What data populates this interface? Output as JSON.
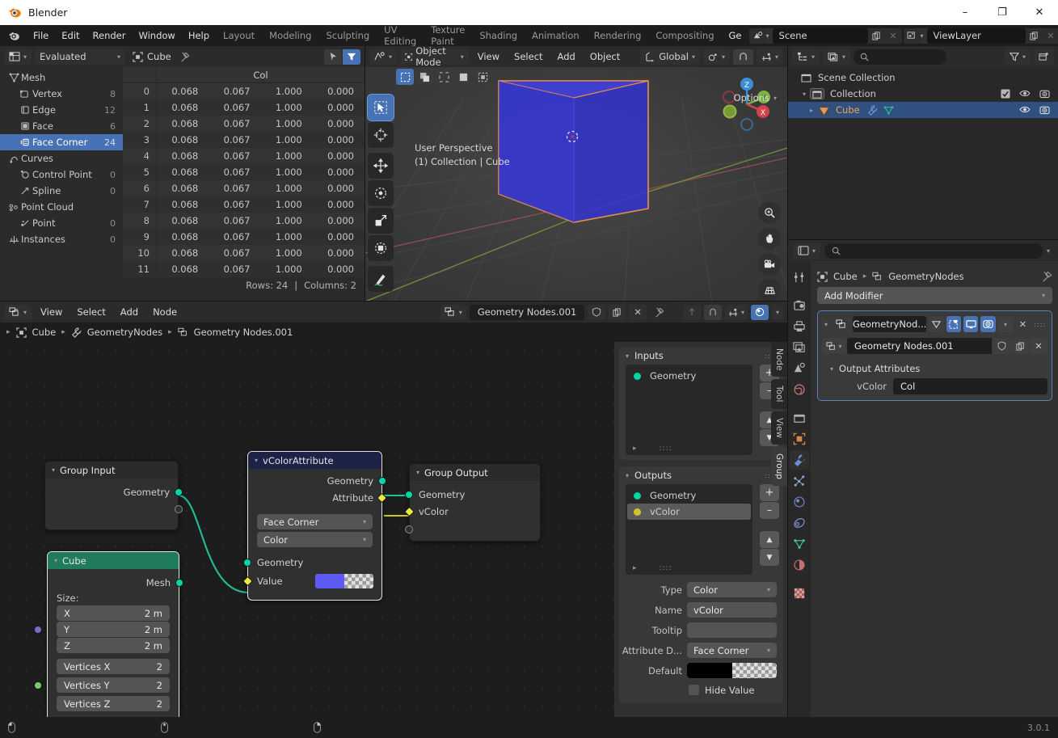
{
  "window": {
    "title": "Blender",
    "minimize": "–",
    "maximize": "❐",
    "close": "✕"
  },
  "topbar": {
    "menus": [
      "File",
      "Edit",
      "Render",
      "Window",
      "Help"
    ],
    "workspaces": [
      "Layout",
      "Modeling",
      "Sculpting",
      "UV Editing",
      "Texture Paint",
      "Shading",
      "Animation",
      "Rendering",
      "Compositing",
      "Ge"
    ],
    "active_workspace": "Ge",
    "scene_name": "Scene",
    "viewlayer_name": "ViewLayer"
  },
  "spreadsheet": {
    "dataset_mode": "Evaluated",
    "object_name": "Cube",
    "column_header": "Col",
    "tree": [
      {
        "label": "Mesh",
        "count": "",
        "icon": "mesh-data-icon",
        "child": false,
        "selected": false
      },
      {
        "label": "Vertex",
        "count": "8",
        "icon": "vertex-icon",
        "child": true,
        "selected": false
      },
      {
        "label": "Edge",
        "count": "12",
        "icon": "edge-icon",
        "child": true,
        "selected": false
      },
      {
        "label": "Face",
        "count": "6",
        "icon": "face-icon",
        "child": true,
        "selected": false
      },
      {
        "label": "Face Corner",
        "count": "24",
        "icon": "face-corner-icon",
        "child": true,
        "selected": true
      },
      {
        "label": "Curves",
        "count": "",
        "icon": "curves-icon",
        "child": false,
        "selected": false
      },
      {
        "label": "Control Point",
        "count": "0",
        "icon": "control-point-icon",
        "child": true,
        "selected": false
      },
      {
        "label": "Spline",
        "count": "0",
        "icon": "spline-icon",
        "child": true,
        "selected": false
      },
      {
        "label": "Point Cloud",
        "count": "",
        "icon": "point-cloud-icon",
        "child": false,
        "selected": false
      },
      {
        "label": "Point",
        "count": "0",
        "icon": "point-icon",
        "child": true,
        "selected": false
      },
      {
        "label": "Instances",
        "count": "0",
        "icon": "instances-icon",
        "child": false,
        "selected": false
      }
    ],
    "rows": [
      {
        "index": "0",
        "cells": [
          "0.068",
          "0.067",
          "1.000",
          "0.000"
        ]
      },
      {
        "index": "1",
        "cells": [
          "0.068",
          "0.067",
          "1.000",
          "0.000"
        ]
      },
      {
        "index": "2",
        "cells": [
          "0.068",
          "0.067",
          "1.000",
          "0.000"
        ]
      },
      {
        "index": "3",
        "cells": [
          "0.068",
          "0.067",
          "1.000",
          "0.000"
        ]
      },
      {
        "index": "4",
        "cells": [
          "0.068",
          "0.067",
          "1.000",
          "0.000"
        ]
      },
      {
        "index": "5",
        "cells": [
          "0.068",
          "0.067",
          "1.000",
          "0.000"
        ]
      },
      {
        "index": "6",
        "cells": [
          "0.068",
          "0.067",
          "1.000",
          "0.000"
        ]
      },
      {
        "index": "7",
        "cells": [
          "0.068",
          "0.067",
          "1.000",
          "0.000"
        ]
      },
      {
        "index": "8",
        "cells": [
          "0.068",
          "0.067",
          "1.000",
          "0.000"
        ]
      },
      {
        "index": "9",
        "cells": [
          "0.068",
          "0.067",
          "1.000",
          "0.000"
        ]
      },
      {
        "index": "10",
        "cells": [
          "0.068",
          "0.067",
          "1.000",
          "0.000"
        ]
      },
      {
        "index": "11",
        "cells": [
          "0.068",
          "0.067",
          "1.000",
          "0.000"
        ]
      }
    ],
    "status_rows": "Rows: 24",
    "status_sep": "|",
    "status_cols": "Columns: 2"
  },
  "viewport": {
    "mode": "Object Mode",
    "menus": [
      "View",
      "Select",
      "Add",
      "Object"
    ],
    "transform_orientation": "Global",
    "options_label": "Options",
    "perspective_line1": "User Perspective",
    "perspective_line2": "(1) Collection | Cube",
    "gizmo_axes": [
      "Z",
      "Y",
      "X"
    ]
  },
  "outliner": {
    "search_placeholder": "",
    "rows": [
      {
        "label": "Scene Collection",
        "icon": "collection-icon",
        "indent": 0,
        "selected": false,
        "has_checkbox": false,
        "restrict": []
      },
      {
        "label": "Collection",
        "icon": "collection-icon",
        "indent": 1,
        "selected": false,
        "has_checkbox": true,
        "restrict": [
          "eye-icon",
          "camera-icon"
        ]
      },
      {
        "label": "Cube",
        "icon": "mesh-object-icon",
        "indent": 2,
        "selected": true,
        "has_checkbox": false,
        "restrict": [
          "eye-icon",
          "camera-icon"
        ]
      }
    ]
  },
  "node_editor": {
    "menus": [
      "View",
      "Select",
      "Add",
      "Node"
    ],
    "tree_name": "Geometry Nodes.001",
    "breadcrumb": [
      "Cube",
      "GeometryNodes",
      "Geometry Nodes.001"
    ],
    "nodes": [
      {
        "name": "Group Input",
        "header_color": "#2b2b2b",
        "selected": false,
        "outputs": [
          "Geometry",
          ""
        ]
      },
      {
        "name": "Cube",
        "header_color": "#1f7a5e",
        "selected": true,
        "output_label": "Mesh",
        "size_label": "Size:",
        "fields": [
          {
            "label": "X",
            "value": "2 m"
          },
          {
            "label": "Y",
            "value": "2 m"
          },
          {
            "label": "Z",
            "value": "2 m"
          },
          {
            "label": "Vertices X",
            "value": "2"
          },
          {
            "label": "Vertices Y",
            "value": "2"
          },
          {
            "label": "Vertices Z",
            "value": "2"
          }
        ]
      },
      {
        "name": "vColorAttribute",
        "header_color": "#1c2347",
        "selected": true,
        "outputs": [
          "Geometry",
          "Attribute"
        ],
        "dropdowns": [
          "Face Corner",
          "Color"
        ],
        "inputs": [
          "Geometry",
          "Value"
        ],
        "value_color": "#5c5cf5"
      },
      {
        "name": "Group Output",
        "header_color": "#2b2b2b",
        "selected": false,
        "inputs": [
          "Geometry",
          "vColor"
        ]
      }
    ],
    "sidebar": {
      "tabs": [
        "Node",
        "Tool",
        "View",
        "Group"
      ],
      "active_tab": "Group",
      "inputs_title": "Inputs",
      "inputs_items": [
        {
          "label": "Geometry",
          "color": "#00d6a3",
          "selected": false
        }
      ],
      "outputs_title": "Outputs",
      "outputs_items": [
        {
          "label": "Geometry",
          "color": "#00d6a3",
          "selected": false
        },
        {
          "label": "vColor",
          "color": "#d2c627",
          "selected": true
        }
      ],
      "add_btn": "+",
      "remove_btn": "–",
      "properties": [
        {
          "label": "Type",
          "value": "Color",
          "kind": "dropdown"
        },
        {
          "label": "Name",
          "value": "vColor",
          "kind": "text"
        },
        {
          "label": "Tooltip",
          "value": "",
          "kind": "text"
        },
        {
          "label": "Attribute D...",
          "value": "Face Corner",
          "kind": "dropdown"
        },
        {
          "label": "Default",
          "value": "",
          "kind": "color",
          "color": "#000000"
        }
      ],
      "hide_value_label": "Hide Value",
      "hide_value_checked": false
    }
  },
  "properties": {
    "search_placeholder": "",
    "breadcrumb": [
      "Cube",
      "GeometryNodes"
    ],
    "add_modifier": "Add Modifier",
    "modifier_name": "GeometryNod...",
    "node_group_name": "Geometry Nodes.001",
    "output_attributes_title": "Output Attributes",
    "output_attribute_label": "vColor",
    "output_attribute_value": "Col",
    "tabs": [
      {
        "name": "tool-icon",
        "active": false
      },
      {
        "name": "render-icon",
        "active": false
      },
      {
        "name": "output-icon",
        "active": false
      },
      {
        "name": "view-layer-icon",
        "active": false
      },
      {
        "name": "scene-icon",
        "active": false
      },
      {
        "name": "world-icon",
        "active": false
      },
      {
        "name": "collection-icon",
        "active": false
      },
      {
        "name": "object-icon",
        "active": false
      },
      {
        "name": "modifier-wrench-icon",
        "active": true
      },
      {
        "name": "particles-icon",
        "active": false
      },
      {
        "name": "physics-icon",
        "active": false
      },
      {
        "name": "constraints-icon",
        "active": false
      },
      {
        "name": "object-data-icon",
        "active": false
      },
      {
        "name": "material-icon",
        "active": false
      },
      {
        "name": "texture-icon",
        "active": false
      }
    ]
  },
  "statusbar": {
    "version": "3.0.1"
  }
}
